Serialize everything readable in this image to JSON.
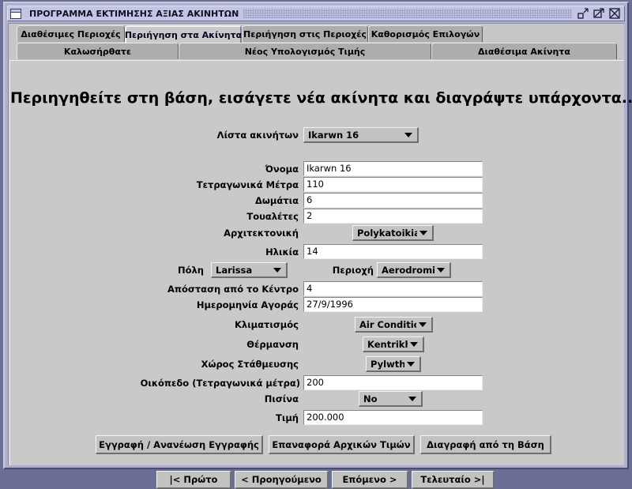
{
  "window": {
    "title": "ΠΡΟΓΡΑΜΜΑ ΕΚΤΙΜΗΣΗΣ ΑΞΙΑΣ ΑΚΙΝΗΤΩΝ",
    "icon": "window-document-icon",
    "controls": [
      {
        "name": "minimize-button",
        "glyph": "minimize-icon"
      },
      {
        "name": "maximize-button",
        "glyph": "maximize-icon"
      },
      {
        "name": "close-button",
        "glyph": "close-icon"
      }
    ],
    "colors": {
      "titlebar": "#c3c5e4",
      "frame": "#aeb0ce",
      "panel": "#c9c9c9",
      "tab_unselected": "#adadad",
      "field": "#ffffff"
    }
  },
  "tabs_row1": [
    {
      "label": "Διαθέσιμες Περιοχές",
      "selected": false
    },
    {
      "label": "Περιήγηση στα Ακίνητα",
      "selected": true
    },
    {
      "label": "Περιήγηση στις Περιοχές",
      "selected": false
    },
    {
      "label": "Καθορισμός Επιλογών",
      "selected": false
    }
  ],
  "tabs_row2": [
    {
      "label": "Καλωσήρθατε",
      "selected": false
    },
    {
      "label": "Νέος Υπολογισμός Τιμής",
      "selected": false
    },
    {
      "label": "Διαθέσιμα Ακίνητα",
      "selected": false
    }
  ],
  "heading": "Περιηγηθείτε στη βάση, εισάγετε νέα ακίνητα και διαγράψτε υπάρχοντα...",
  "selector": {
    "label": "Λίστα ακινήτων",
    "value": "Ikarwn 16"
  },
  "fields": {
    "name": {
      "label": "Όνομα",
      "value": "Ikarwn 16"
    },
    "sqm": {
      "label": "Τετραγωνικά Μέτρα",
      "value": "110"
    },
    "rooms": {
      "label": "Δωμάτια",
      "value": "6"
    },
    "wc": {
      "label": "Τουαλέτες",
      "value": "2"
    },
    "architecture": {
      "label": "Αρχιτεκτονική",
      "value": "Polykatoikia"
    },
    "age": {
      "label": "Ηλικία",
      "value": "14"
    },
    "city": {
      "label": "Πόλη",
      "value": "Larissa"
    },
    "area": {
      "label": "Περιοχή",
      "value": "Aerodromio"
    },
    "distance": {
      "label": "Απόσταση από το Κέντρο",
      "value": "4"
    },
    "purchase": {
      "label": "Ημερομηνία Αγοράς",
      "value": "27/9/1996"
    },
    "aircon": {
      "label": "Κλιματισμός",
      "value": "Air Condition"
    },
    "heating": {
      "label": "Θέρμανση",
      "value": "Kentrikh"
    },
    "parking": {
      "label": "Χώρος Στάθμευσης",
      "value": "Pylwth"
    },
    "plot": {
      "label": "Οικόπεδο (Τετραγωνικά μέτρα)",
      "value": "200"
    },
    "pool": {
      "label": "Πισίνα",
      "value": "No"
    },
    "price": {
      "label": "Τιμή",
      "value": "200.000"
    }
  },
  "actions": [
    {
      "label": "Εγγραφή / Ανανέωση Εγγραφής"
    },
    {
      "label": "Επαναφορά Αρχικών Τιμών"
    },
    {
      "label": "Διαγραφή από τη Βάση"
    }
  ],
  "navigation": [
    {
      "label": "|< Πρώτο"
    },
    {
      "label": "< Προηγούμενο"
    },
    {
      "label": "Επόμενο >"
    },
    {
      "label": "Τελευταίο >|"
    }
  ]
}
